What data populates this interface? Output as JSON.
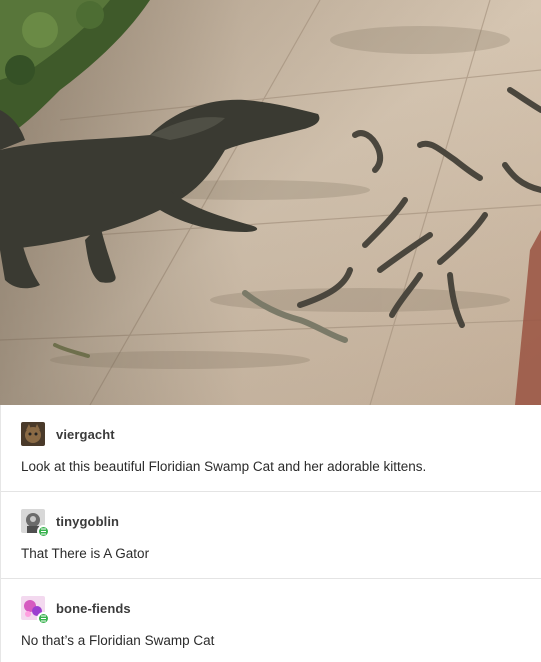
{
  "image": {
    "alt": "",
    "description_icon": "alligator-photo"
  },
  "posts": [
    {
      "username": "viergacht",
      "text": "Look at this beautiful Floridian Swamp Cat and her adorable kittens.",
      "avatar_icon": "cat-avatar-icon",
      "badge": false
    },
    {
      "username": "tinygoblin",
      "text": "That There is A Gator",
      "avatar_icon": "goblin-avatar-icon",
      "badge": true
    },
    {
      "username": "bone-fiends",
      "text": "No that’s a Floridian Swamp Cat",
      "avatar_icon": "pink-avatar-icon",
      "badge": true
    }
  ],
  "colors": {
    "badge_green": "#37b24d",
    "pavement": "#c9b8a4",
    "gator": "#3a3a32"
  }
}
